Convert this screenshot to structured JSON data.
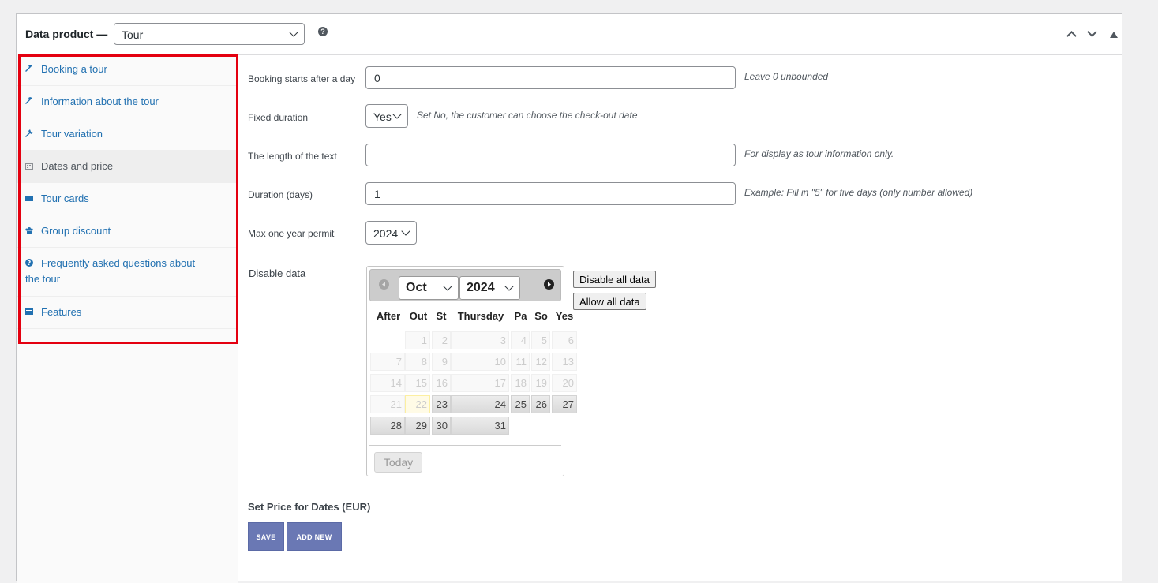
{
  "header": {
    "title": "Data product —",
    "product_type": "Tour",
    "help_icon": "question-circle-icon",
    "icons": [
      "chevron-up-icon",
      "chevron-down-icon",
      "collapse-triangle-icon"
    ]
  },
  "sidebar": {
    "items": [
      {
        "label": "Booking a tour",
        "icon": "wrench-icon"
      },
      {
        "label": "Information about the tour",
        "icon": "wrench-icon"
      },
      {
        "label": "Tour variation",
        "icon": "tools-icon"
      },
      {
        "label": "Dates and price",
        "icon": "calendar-icon"
      },
      {
        "label": "Tour cards",
        "icon": "folder-icon"
      },
      {
        "label": "Group discount",
        "icon": "groups-icon"
      },
      {
        "label": "Frequently asked questions about the tour",
        "icon": "question-icon"
      },
      {
        "label": "Features",
        "icon": "list-view-icon"
      }
    ],
    "active_index": 3,
    "highlight_color": "#e40010"
  },
  "form": {
    "booking_starts": {
      "label": "Booking starts after a day",
      "value": "0",
      "desc": "Leave 0 unbounded"
    },
    "fixed_duration": {
      "label": "Fixed duration",
      "value": "Yes",
      "desc": "Set No, the customer can choose the check-out date"
    },
    "length_text": {
      "label": "The length of the text",
      "value": "",
      "desc": "For display as tour information only."
    },
    "duration_days": {
      "label": "Duration (days)",
      "value": "1",
      "desc": "Example: Fill in \"5\" for five days (only number allowed)"
    },
    "max_year": {
      "label": "Max one year permit",
      "value": "2024"
    },
    "disable_data": {
      "label": "Disable data"
    }
  },
  "calendar": {
    "month": "Oct",
    "year": "2024",
    "weekdays": [
      "After",
      "Out",
      "St",
      "Thursday",
      "Pa",
      "So",
      "Yes"
    ],
    "weeks": [
      [
        "",
        "1",
        "2",
        "3",
        "4",
        "5",
        "6"
      ],
      [
        "7",
        "8",
        "9",
        "10",
        "11",
        "12",
        "13"
      ],
      [
        "14",
        "15",
        "16",
        "17",
        "18",
        "19",
        "20"
      ],
      [
        "21",
        "22",
        "23",
        "24",
        "25",
        "26",
        "27"
      ],
      [
        "28",
        "29",
        "30",
        "31",
        "",
        "",
        ""
      ]
    ],
    "today_label": "Today",
    "buttons": {
      "disable_all": "Disable all data",
      "allow_all": "Allow all data"
    }
  },
  "price": {
    "title": "Set Price for Dates (EUR)",
    "save_label": "SAVE",
    "add_new_label": "ADD NEW",
    "button_color": "#6a78b4"
  }
}
